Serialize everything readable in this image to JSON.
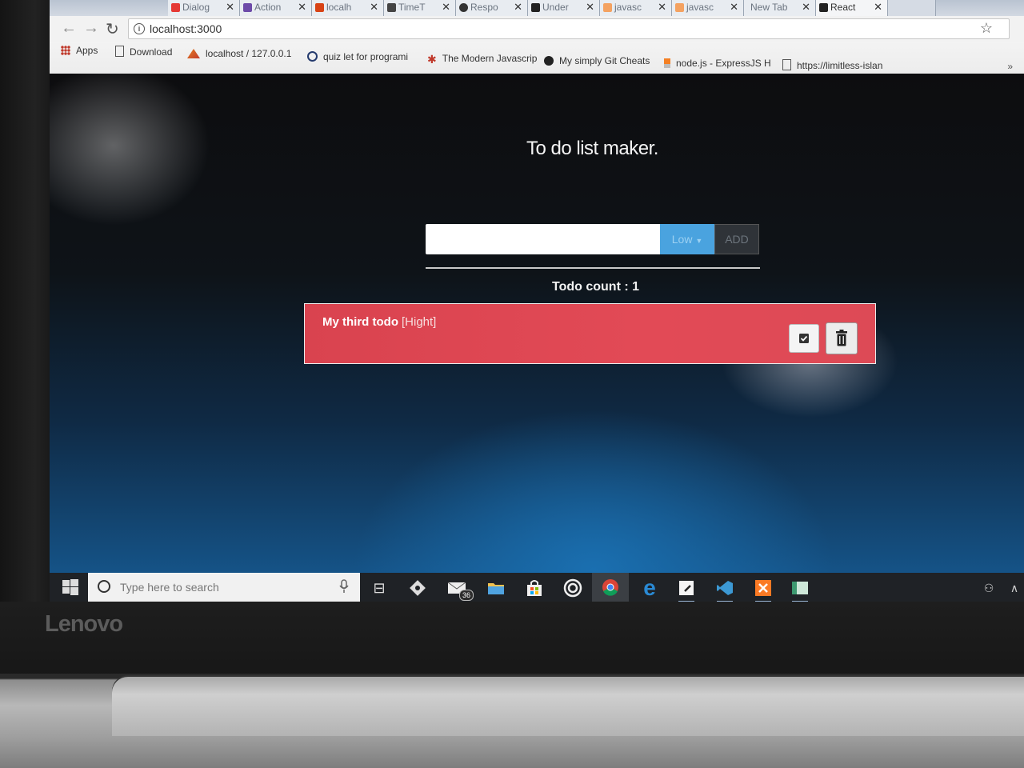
{
  "browser": {
    "tabs": [
      {
        "label": "Dialog",
        "color": "#e53935"
      },
      {
        "label": "Action",
        "color": "#6d4aa8"
      },
      {
        "label": "localh",
        "color": "#d84315"
      },
      {
        "label": "TimeT",
        "color": "#444444"
      },
      {
        "label": "Respo",
        "color": "#333333"
      },
      {
        "label": "Under",
        "color": "#222222"
      },
      {
        "label": "javasc",
        "color": "#f4a261"
      },
      {
        "label": "javasc",
        "color": "#f4a261"
      },
      {
        "label": "New Tab",
        "color": "#cfd6df"
      },
      {
        "label": "React",
        "color": "#222222"
      }
    ],
    "url": "localhost:3000",
    "bookmarks": [
      {
        "label": "Apps",
        "icon": "apps-grid-icon"
      },
      {
        "label": "Download",
        "icon": "page-icon"
      },
      {
        "label": "localhost / 127.0.0.1",
        "icon": "phpmyadmin-icon"
      },
      {
        "label": "quiz let for programi",
        "icon": "quizlet-icon"
      },
      {
        "label": "The Modern Javascrip",
        "icon": "person-icon"
      },
      {
        "label": "My simply Git Cheats",
        "icon": "github-icon"
      },
      {
        "label": "node.js - ExpressJS H",
        "icon": "stackoverflow-icon"
      },
      {
        "label": "https://limitless-islan",
        "icon": "page-icon"
      }
    ]
  },
  "app": {
    "title": "To do list maker.",
    "input_value": "",
    "priority_selected": "Low",
    "add_label": "ADD",
    "count_label": "Todo count : ",
    "count_value": "1",
    "todos": [
      {
        "text": "My third todo",
        "priority": "[Hight]",
        "color": "#e04653"
      }
    ]
  },
  "taskbar": {
    "search_placeholder": "Type here to search",
    "mail_badge": "36"
  },
  "laptop": {
    "brand": "Lenovo"
  }
}
